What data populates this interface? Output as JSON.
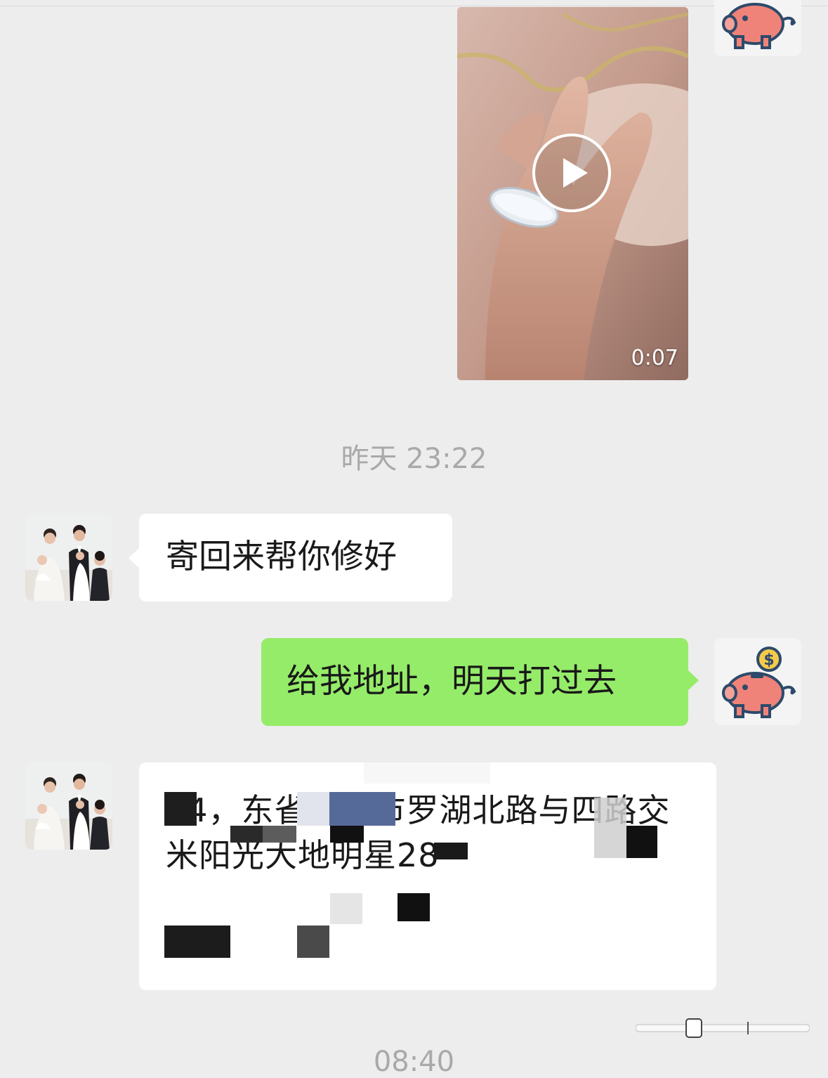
{
  "video_message": {
    "duration": "0:07",
    "play_icon": "play-icon"
  },
  "timestamps": {
    "divider_1": "昨天 23:22",
    "divider_2": "08:40"
  },
  "messages": [
    {
      "side": "left",
      "sender": "contact",
      "text": "寄回来帮你修好"
    },
    {
      "side": "right",
      "sender": "me",
      "text": "给我地址，明天打过去"
    },
    {
      "side": "left",
      "sender": "contact",
      "text": "44，东省深圳市罗湖北路与四路交米阳光大地明星28"
    }
  ],
  "avatars": {
    "contact": "family-photo-avatar",
    "me": "piggy-bank-avatar"
  },
  "colors": {
    "background": "#ededed",
    "my_bubble": "#95ec69",
    "their_bubble": "#ffffff",
    "timestamp": "#a9a9a9"
  }
}
